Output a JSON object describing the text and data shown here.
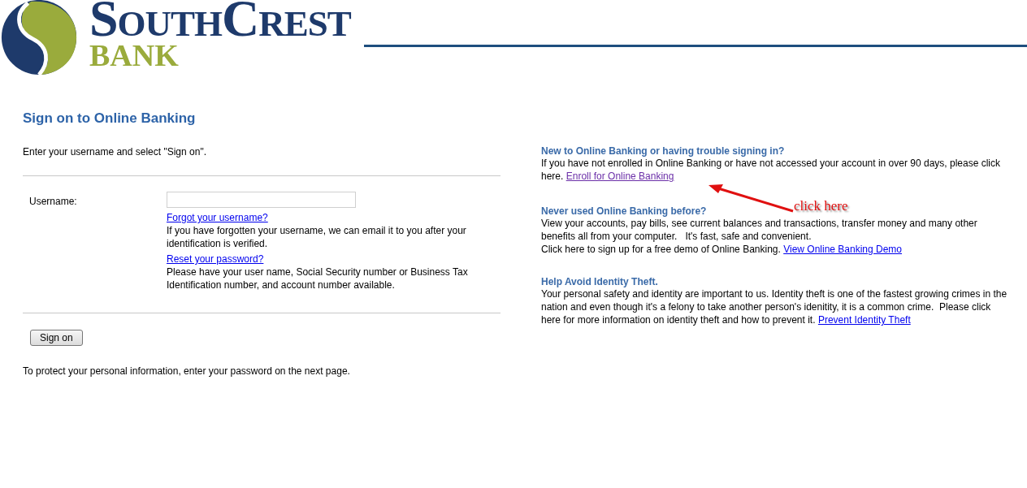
{
  "logo": {
    "line_1": "SouthCrest",
    "line_2": "BANK"
  },
  "signon": {
    "title": "Sign on to Online Banking",
    "intro": "Enter your username and select \"Sign on\".",
    "username": {
      "label": "Username:"
    },
    "help": [
      {
        "link": {
          "label": "Forgot your username?",
          "visited": false
        },
        "text": "If you have forgotten your username, we can email it to you after your identification is verified."
      },
      {
        "link": {
          "label": "Reset your password?",
          "visited": false
        },
        "text": "Please have your user name, Social Security number or Business Tax Identification number, and account number available."
      }
    ],
    "button": "Sign on",
    "note": "To protect your personal information, enter your password on the next page."
  },
  "sections": [
    {
      "heading": "New to Online Banking or having trouble signing in?",
      "paragraphs": [
        {
          "text": "If you have not enrolled in Online Banking or have not accessed your account in over 90 days, please click here.",
          "link": {
            "label": "Enroll for Online Banking",
            "visited": true
          }
        }
      ]
    },
    {
      "heading": "Never used Online Banking before?",
      "paragraphs": [
        {
          "text": "View your accounts, pay bills, see current balances and transactions, transfer money and many other benefits all from your computer.   It's fast, safe and convenient."
        },
        {
          "text": "Click here to sign up for a free demo of Online Banking.",
          "link": {
            "label": "View Online Banking Demo",
            "visited": false
          }
        }
      ]
    },
    {
      "heading": "Help Avoid Identity Theft.",
      "paragraphs": [
        {
          "text": "Your personal safety and identity are important to us. Identity theft is one of the fastest growing crimes in the nation and even though it's a felony to take another person's idenitity, it is a common crime.  Please click here for more information on identity theft and how to prevent it.",
          "link": {
            "label": "Prevent Identity Theft",
            "visited": false
          }
        }
      ]
    }
  ],
  "annotation": {
    "text": "click here"
  }
}
